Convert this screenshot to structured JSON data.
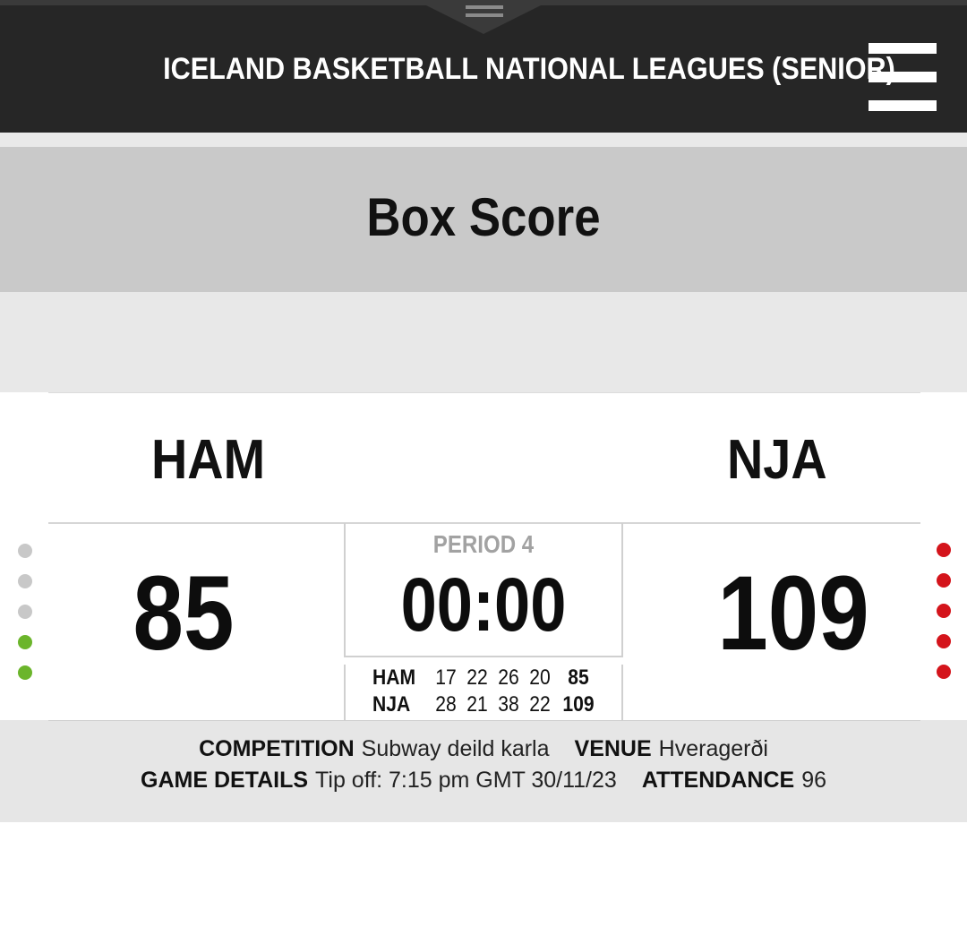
{
  "header": {
    "site_title": "ICELAND BASKETBALL NATIONAL LEAGUES (SENIOR)",
    "menu_icon": "hamburger-menu-icon",
    "handle_icon": "drag-handle-icon"
  },
  "page": {
    "title": "Box Score"
  },
  "game": {
    "home": {
      "abbr": "HAM",
      "score": "85",
      "quarters": [
        "17",
        "22",
        "26",
        "20"
      ],
      "total": "85",
      "timeout_dots": [
        "used",
        "used",
        "used",
        "remaining",
        "remaining"
      ],
      "dot_color": "#6bb52b"
    },
    "away": {
      "abbr": "NJA",
      "score": "109",
      "quarters": [
        "28",
        "21",
        "38",
        "22"
      ],
      "total": "109",
      "timeout_dots": [
        "remaining",
        "remaining",
        "remaining",
        "remaining",
        "remaining"
      ],
      "dot_color": "#d4141b"
    },
    "period": "PERIOD 4",
    "clock": "00:00"
  },
  "details": {
    "competition_label": "COMPETITION",
    "competition_value": "Subway deild karla",
    "venue_label": "VENUE",
    "venue_value": "Hveragerði",
    "game_details_label": "GAME DETAILS",
    "game_details_value": "Tip off: 7:15 pm GMT 30/11/23",
    "attendance_label": "ATTENDANCE",
    "attendance_value": "96"
  },
  "colors": {
    "header_bg": "#262626",
    "title_band_bg": "#c9c9c9",
    "used_dot": "#c8c8c8",
    "home_dot": "#6bb52b",
    "away_dot": "#d4141b"
  }
}
